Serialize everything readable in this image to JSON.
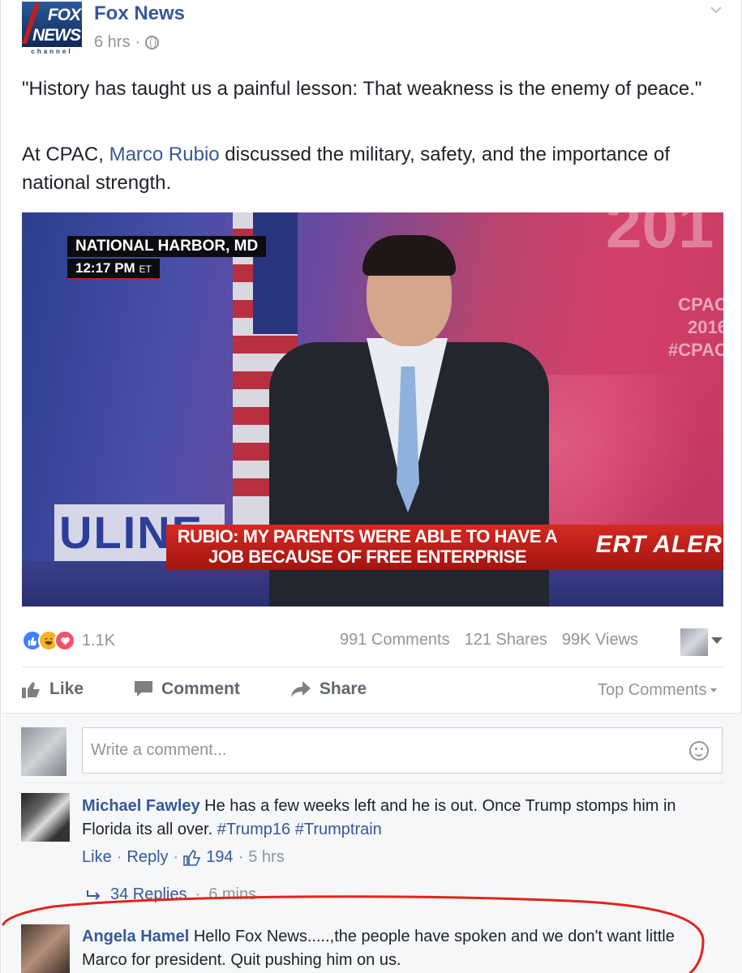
{
  "post": {
    "page_name": "Fox News",
    "logo": {
      "line1": "FOX",
      "line2": "NEWS",
      "line3": "channel"
    },
    "time": "6 hrs",
    "separator": "·",
    "paragraph1": "\"History has taught us a painful lesson: That weakness is the enemy of peace.\"",
    "paragraph2_before": "At CPAC, ",
    "paragraph2_link": "Marco Rubio",
    "paragraph2_after": " discussed the military, safety, and the importance of national strength."
  },
  "video": {
    "location": "NATIONAL HARBOR, MD",
    "time": "12:17 PM",
    "time_zone": "ET",
    "headline": "RUBIO: MY PARENTS WERE ABLE TO HAVE A JOB BECAUSE OF FREE ENTERPRISE",
    "alert_text": "ERT  ALER",
    "sponsor": "ULINE",
    "bg_text": "CPAC 2016 #CPAC",
    "year_text": "201"
  },
  "stats": {
    "reaction_count": "1.1K",
    "comments": "991 Comments",
    "shares": "121 Shares",
    "views": "99K Views"
  },
  "actions": {
    "like": "Like",
    "comment": "Comment",
    "share": "Share",
    "top_comments": "Top Comments"
  },
  "composer": {
    "placeholder": "Write a comment..."
  },
  "comments": [
    {
      "name": "Michael Fawley",
      "text": " He has a few weeks left and he is out. Once Trump stomps him in Florida its all over. ",
      "hashtag1": "#Trump16",
      "hashtag2": "#Trumptrain",
      "like": "Like",
      "reply": "Reply",
      "likes": "194",
      "time": "5 hrs",
      "replies": "34 Replies",
      "replies_time": "6 mins"
    },
    {
      "name": "Angela Hamel",
      "text": " Hello Fox News.....,the people have spoken and we don't want little Marco for president. Quit pushing him on us."
    }
  ],
  "colors": {
    "link": "#365899",
    "meta": "#90949c",
    "annotation": "#e0241c"
  }
}
